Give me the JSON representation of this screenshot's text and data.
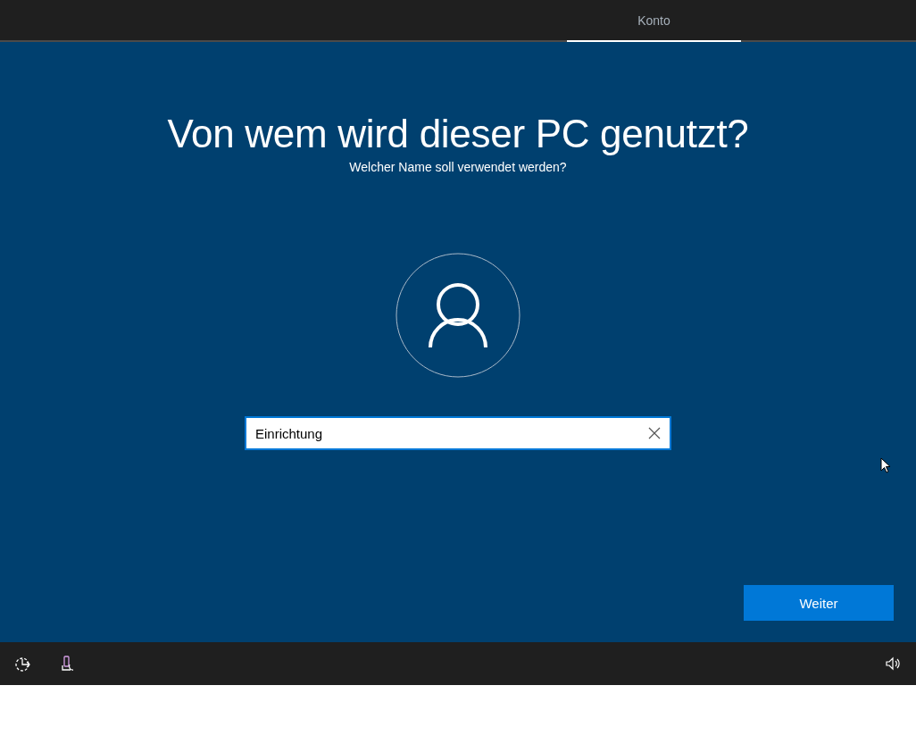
{
  "tabs": [
    {
      "label": "Konto",
      "selected": true
    }
  ],
  "heading": "Von wem wird dieser PC genutzt?",
  "subheading": "Welcher Name soll verwendet werden?",
  "name_field": {
    "value": "Einrichtung"
  },
  "buttons": [
    "Weiter"
  ]
}
